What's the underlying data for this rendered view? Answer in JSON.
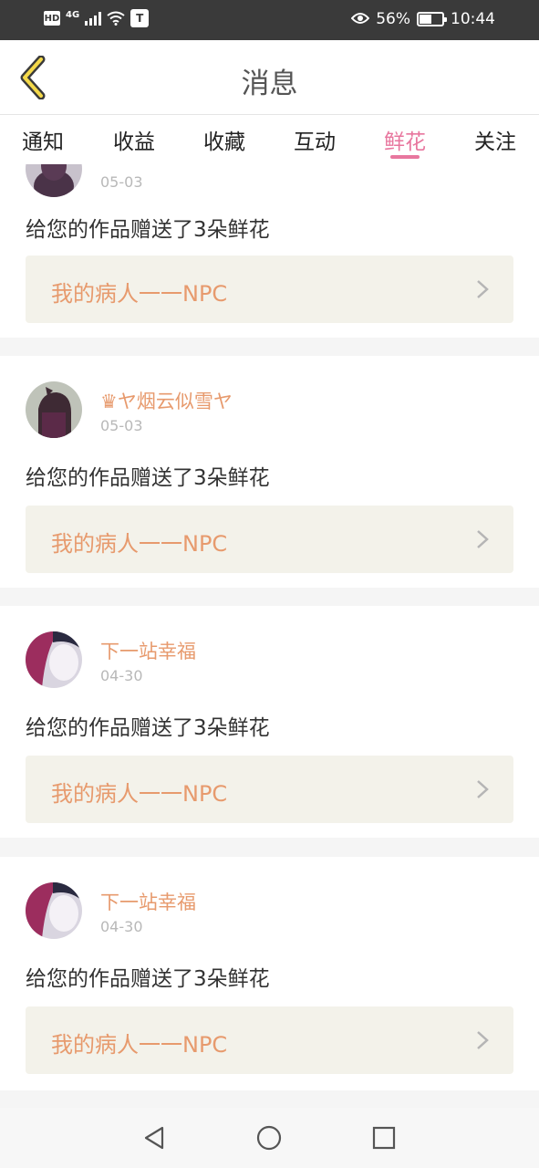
{
  "status_bar": {
    "hd": "HD",
    "network": "4G",
    "battery_text": "56%",
    "battery_level": 0.56,
    "time": "10:44"
  },
  "header": {
    "title": "消息"
  },
  "tabs": [
    {
      "label": "通知",
      "active": false
    },
    {
      "label": "收益",
      "active": false
    },
    {
      "label": "收藏",
      "active": false
    },
    {
      "label": "互动",
      "active": false
    },
    {
      "label": "鲜花",
      "active": true
    },
    {
      "label": "关注",
      "active": false
    }
  ],
  "colors": {
    "accent": "#e8769e",
    "username": "#e79a6d",
    "card_link_bg": "#f3f2ea"
  },
  "notifications": [
    {
      "username": "",
      "date": "05-03",
      "message": "给您的作品赠送了3朵鲜花",
      "work_title": "我的病人一一NPC"
    },
    {
      "username": "♛ヤ烟云似雪ヤ",
      "date": "05-03",
      "message": "给您的作品赠送了3朵鲜花",
      "work_title": "我的病人一一NPC"
    },
    {
      "username": "下一站幸福",
      "date": "04-30",
      "message": "给您的作品赠送了3朵鲜花",
      "work_title": "我的病人一一NPC"
    },
    {
      "username": "下一站幸福",
      "date": "04-30",
      "message": "给您的作品赠送了3朵鲜花",
      "work_title": "我的病人一一NPC"
    }
  ],
  "icons": {
    "back": "chevron-left-icon",
    "nav_back": "triangle-back-icon",
    "nav_home": "circle-home-icon",
    "nav_recents": "square-recents-icon"
  }
}
